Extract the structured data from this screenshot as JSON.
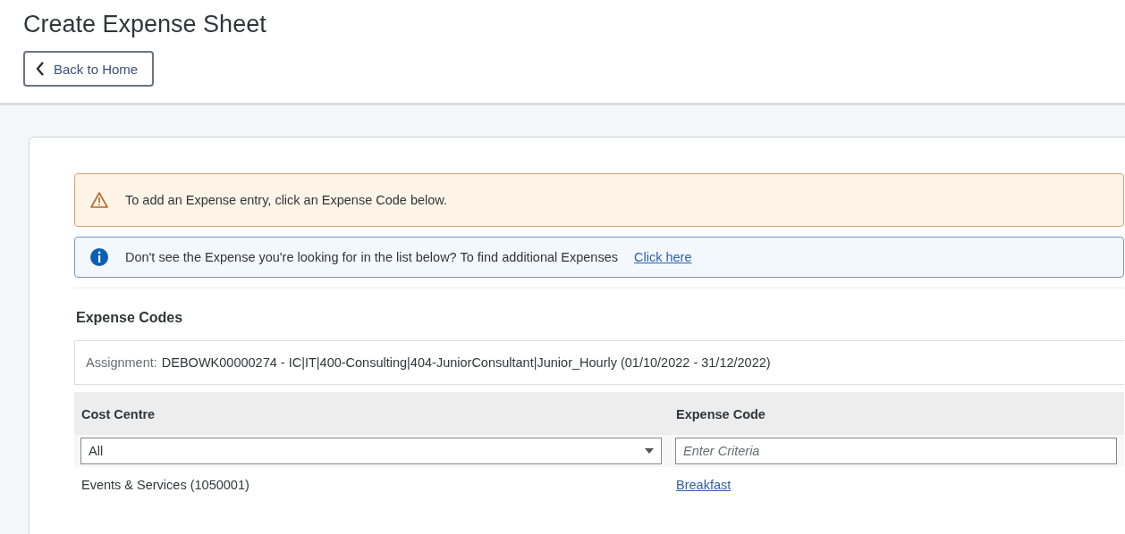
{
  "page_title": "Create Expense Sheet",
  "back_button": {
    "label": "Back to Home"
  },
  "alerts": [
    {
      "kind": "warning",
      "text": "To add an Expense entry, click an Expense Code below."
    },
    {
      "kind": "info",
      "text": "Don't see the Expense you're looking for in the list below? To find additional Expenses",
      "link": "Click here"
    }
  ],
  "section_title": "Expense Codes",
  "assignment": {
    "label": "Assignment:",
    "value": "DEBOWK00000274 - IC|IT|400-Consulting|404-JuniorConsultant|Junior_Hourly (01/10/2022 - 31/12/2022)"
  },
  "table": {
    "columns": [
      "Cost Centre",
      "Expense Code"
    ],
    "filters": {
      "cost_centre": "All",
      "expense_code_placeholder": "Enter Criteria"
    },
    "rows": [
      {
        "cost_centre": "Events & Services (1050001)",
        "expense_code": "Breakfast"
      }
    ]
  }
}
